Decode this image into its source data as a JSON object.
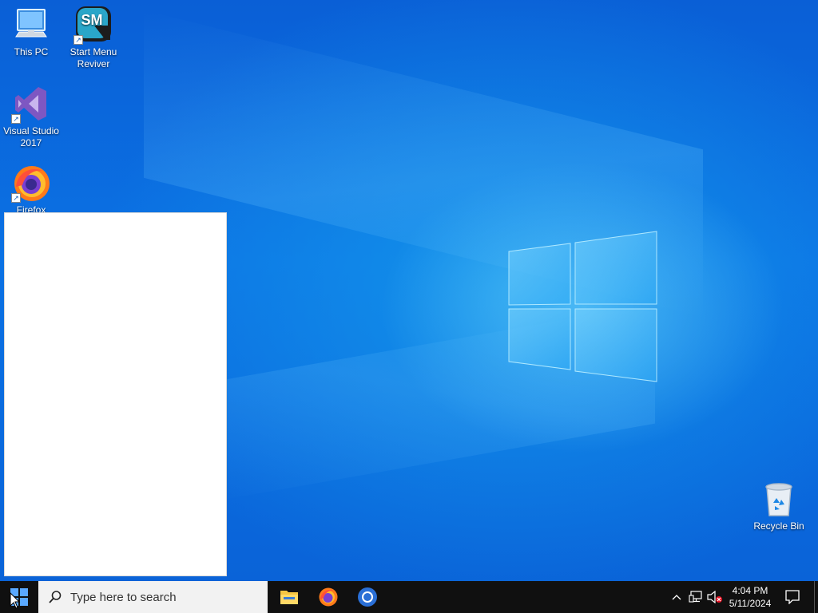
{
  "desktop": {
    "icons": [
      {
        "label_line1": "This PC",
        "label_line2": "",
        "icon": "this-pc-icon"
      },
      {
        "label_line1": "Start Menu",
        "label_line2": "Reviver",
        "icon": "start-menu-reviver-icon",
        "logo_text": "SM"
      },
      {
        "label_line1": "Visual Studio",
        "label_line2": "2017",
        "icon": "visual-studio-icon"
      },
      {
        "label_line1": "Firefox",
        "label_line2": "",
        "icon": "firefox-icon"
      },
      {
        "label_line1": "Recycle Bin",
        "label_line2": "",
        "icon": "recycle-bin-icon"
      }
    ],
    "background_color": "#0b6fe0"
  },
  "taskbar": {
    "search_placeholder": "Type here to search",
    "pinned_apps": [
      "file-explorer-icon",
      "firefox-icon",
      "chrome-icon"
    ],
    "clock_time": "4:04 PM",
    "clock_date": "5/11/2024",
    "tray_icons": [
      "chevron-up-icon",
      "network-icon",
      "volume-muted-icon",
      "action-center-icon"
    ]
  }
}
